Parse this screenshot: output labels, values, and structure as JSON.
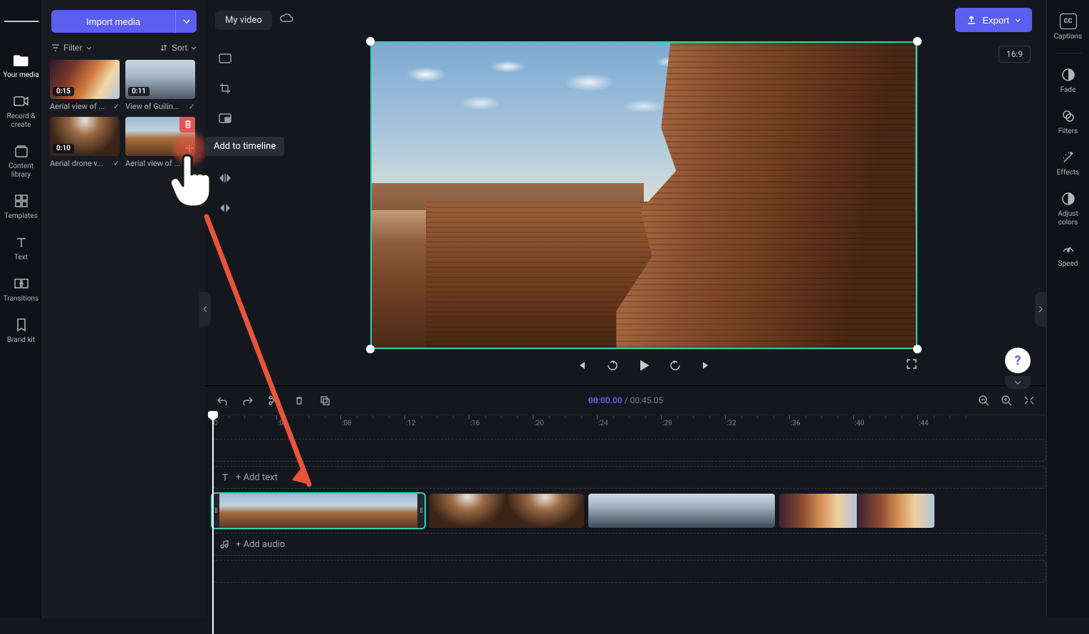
{
  "leftRail": {
    "items": [
      {
        "label": "Your media"
      },
      {
        "label": "Record & create"
      },
      {
        "label": "Content library"
      },
      {
        "label": "Templates"
      },
      {
        "label": "Text"
      },
      {
        "label": "Transitions"
      },
      {
        "label": "Brand kit"
      }
    ]
  },
  "mediaPanel": {
    "importLabel": "Import media",
    "filterLabel": "Filter",
    "sortLabel": "Sort",
    "items": [
      {
        "duration": "0:15",
        "label": "Aerial view of ..."
      },
      {
        "duration": "0:11",
        "label": "View of Guilin..."
      },
      {
        "duration": "0:10",
        "label": "Aerial drone v..."
      },
      {
        "duration": "",
        "label": "Aerial view of ..."
      }
    ]
  },
  "tooltip": {
    "addToTimeline": "Add to timeline"
  },
  "topBar": {
    "title": "My video",
    "exportLabel": "Export",
    "aspect": "16:9"
  },
  "playback": {
    "current": "00:00.00",
    "total": "00:45.05"
  },
  "ruler": {
    "ticks": [
      "0",
      ":04",
      ":08",
      ":12",
      ":16",
      ":20",
      ":24",
      ":28",
      ":32",
      ":36",
      ":40",
      ":44"
    ]
  },
  "tracks": {
    "textPlaceholder": "+ Add text",
    "audioPlaceholder": "+ Add audio"
  },
  "rightRail": {
    "items": [
      {
        "label": "Captions"
      },
      {
        "label": "Fade"
      },
      {
        "label": "Filters"
      },
      {
        "label": "Effects"
      },
      {
        "label": "Adjust colors"
      },
      {
        "label": "Speed"
      }
    ]
  },
  "help": {
    "symbol": "?"
  }
}
